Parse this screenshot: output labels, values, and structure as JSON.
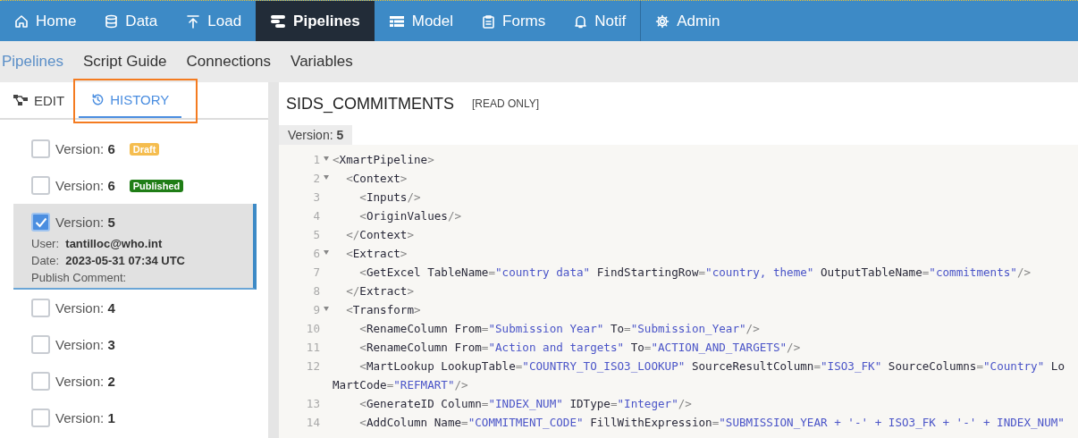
{
  "nav": [
    {
      "label": "Home",
      "selected": false
    },
    {
      "label": "Data",
      "selected": false
    },
    {
      "label": "Load",
      "selected": false
    },
    {
      "label": "Pipelines",
      "selected": true
    },
    {
      "label": "Model",
      "selected": false
    },
    {
      "label": "Forms",
      "selected": false
    },
    {
      "label": "Notif",
      "selected": false
    },
    {
      "label": "Admin",
      "selected": false
    }
  ],
  "subnav": [
    {
      "label": "Pipelines",
      "selected": true
    },
    {
      "label": "Script Guide",
      "selected": false
    },
    {
      "label": "Connections",
      "selected": false
    },
    {
      "label": "Variables",
      "selected": false
    }
  ],
  "panel_tabs": [
    {
      "label": "EDIT",
      "selected": false,
      "highlighted": false
    },
    {
      "label": "HISTORY",
      "selected": true,
      "highlighted": true
    }
  ],
  "versions": [
    {
      "label": "Version:",
      "number": "6",
      "checked": false,
      "selected": false,
      "badge": {
        "text": "Draft",
        "color": "#f5bd4f"
      }
    },
    {
      "label": "Version:",
      "number": "6",
      "checked": false,
      "selected": false,
      "badge": {
        "text": "Published",
        "color": "#1f7d16"
      }
    },
    {
      "label": "Version:",
      "number": "5",
      "checked": true,
      "selected": true,
      "details": [
        {
          "label": "User:",
          "value": "tantilloc@who.int"
        },
        {
          "label": "Date:",
          "value": "2023-05-31 07:34 UTC"
        },
        {
          "label": "Publish Comment:"
        }
      ]
    },
    {
      "label": "Version:",
      "number": "4",
      "checked": false,
      "selected": false
    },
    {
      "label": "Version:",
      "number": "3",
      "checked": false,
      "selected": false
    },
    {
      "label": "Version:",
      "number": "2",
      "checked": false,
      "selected": false
    },
    {
      "label": "Version:",
      "number": "1",
      "checked": false,
      "selected": false
    }
  ],
  "editor": {
    "title": "SIDS_COMMITMENTS",
    "mode": "[READ ONLY]",
    "version_tab": {
      "label": "Version:",
      "number": "5"
    },
    "lines": [
      {
        "number": "1",
        "foldable": true,
        "text": "<XmartPipeline>"
      },
      {
        "number": "2",
        "foldable": true,
        "text": "  <Context>"
      },
      {
        "number": "3",
        "foldable": false,
        "text": "    <Inputs/>"
      },
      {
        "number": "4",
        "foldable": false,
        "text": "    <OriginValues/>"
      },
      {
        "number": "5",
        "foldable": false,
        "text": "  </Context>"
      },
      {
        "number": "6",
        "foldable": true,
        "text": "  <Extract>"
      },
      {
        "number": "7",
        "foldable": false,
        "text": "    <GetExcel TableName=\"country data\" FindStartingRow=\"country, theme\" OutputTableName=\"commitments\"/>"
      },
      {
        "number": "8",
        "foldable": false,
        "text": "  </Extract>"
      },
      {
        "number": "9",
        "foldable": true,
        "text": "  <Transform>"
      },
      {
        "number": "10",
        "foldable": false,
        "text": "    <RenameColumn From=\"Submission Year\" To=\"Submission_Year\"/>"
      },
      {
        "number": "11",
        "foldable": false,
        "text": "    <RenameColumn From=\"Action and targets\" To=\"ACTION_AND_TARGETS\"/>"
      },
      {
        "number": "12",
        "foldable": false,
        "text": "    <MartLookup LookupTable=\"COUNTRY_TO_ISO3_LOOKUP\" SourceResultColumn=\"ISO3_FK\" SourceColumns=\"Country\" Lo",
        "wrap": "MartCode=\"REFMART\"/>"
      },
      {
        "number": "13",
        "foldable": false,
        "text": "    <GenerateID Column=\"INDEX_NUM\" IDType=\"Integer\"/>"
      },
      {
        "number": "14",
        "foldable": false,
        "text": "    <AddColumn Name=\"COMMITMENT_CODE\" FillWithExpression=\"SUBMISSION_YEAR + '-' + ISO3_FK + '-' + INDEX_NUM\""
      }
    ]
  }
}
